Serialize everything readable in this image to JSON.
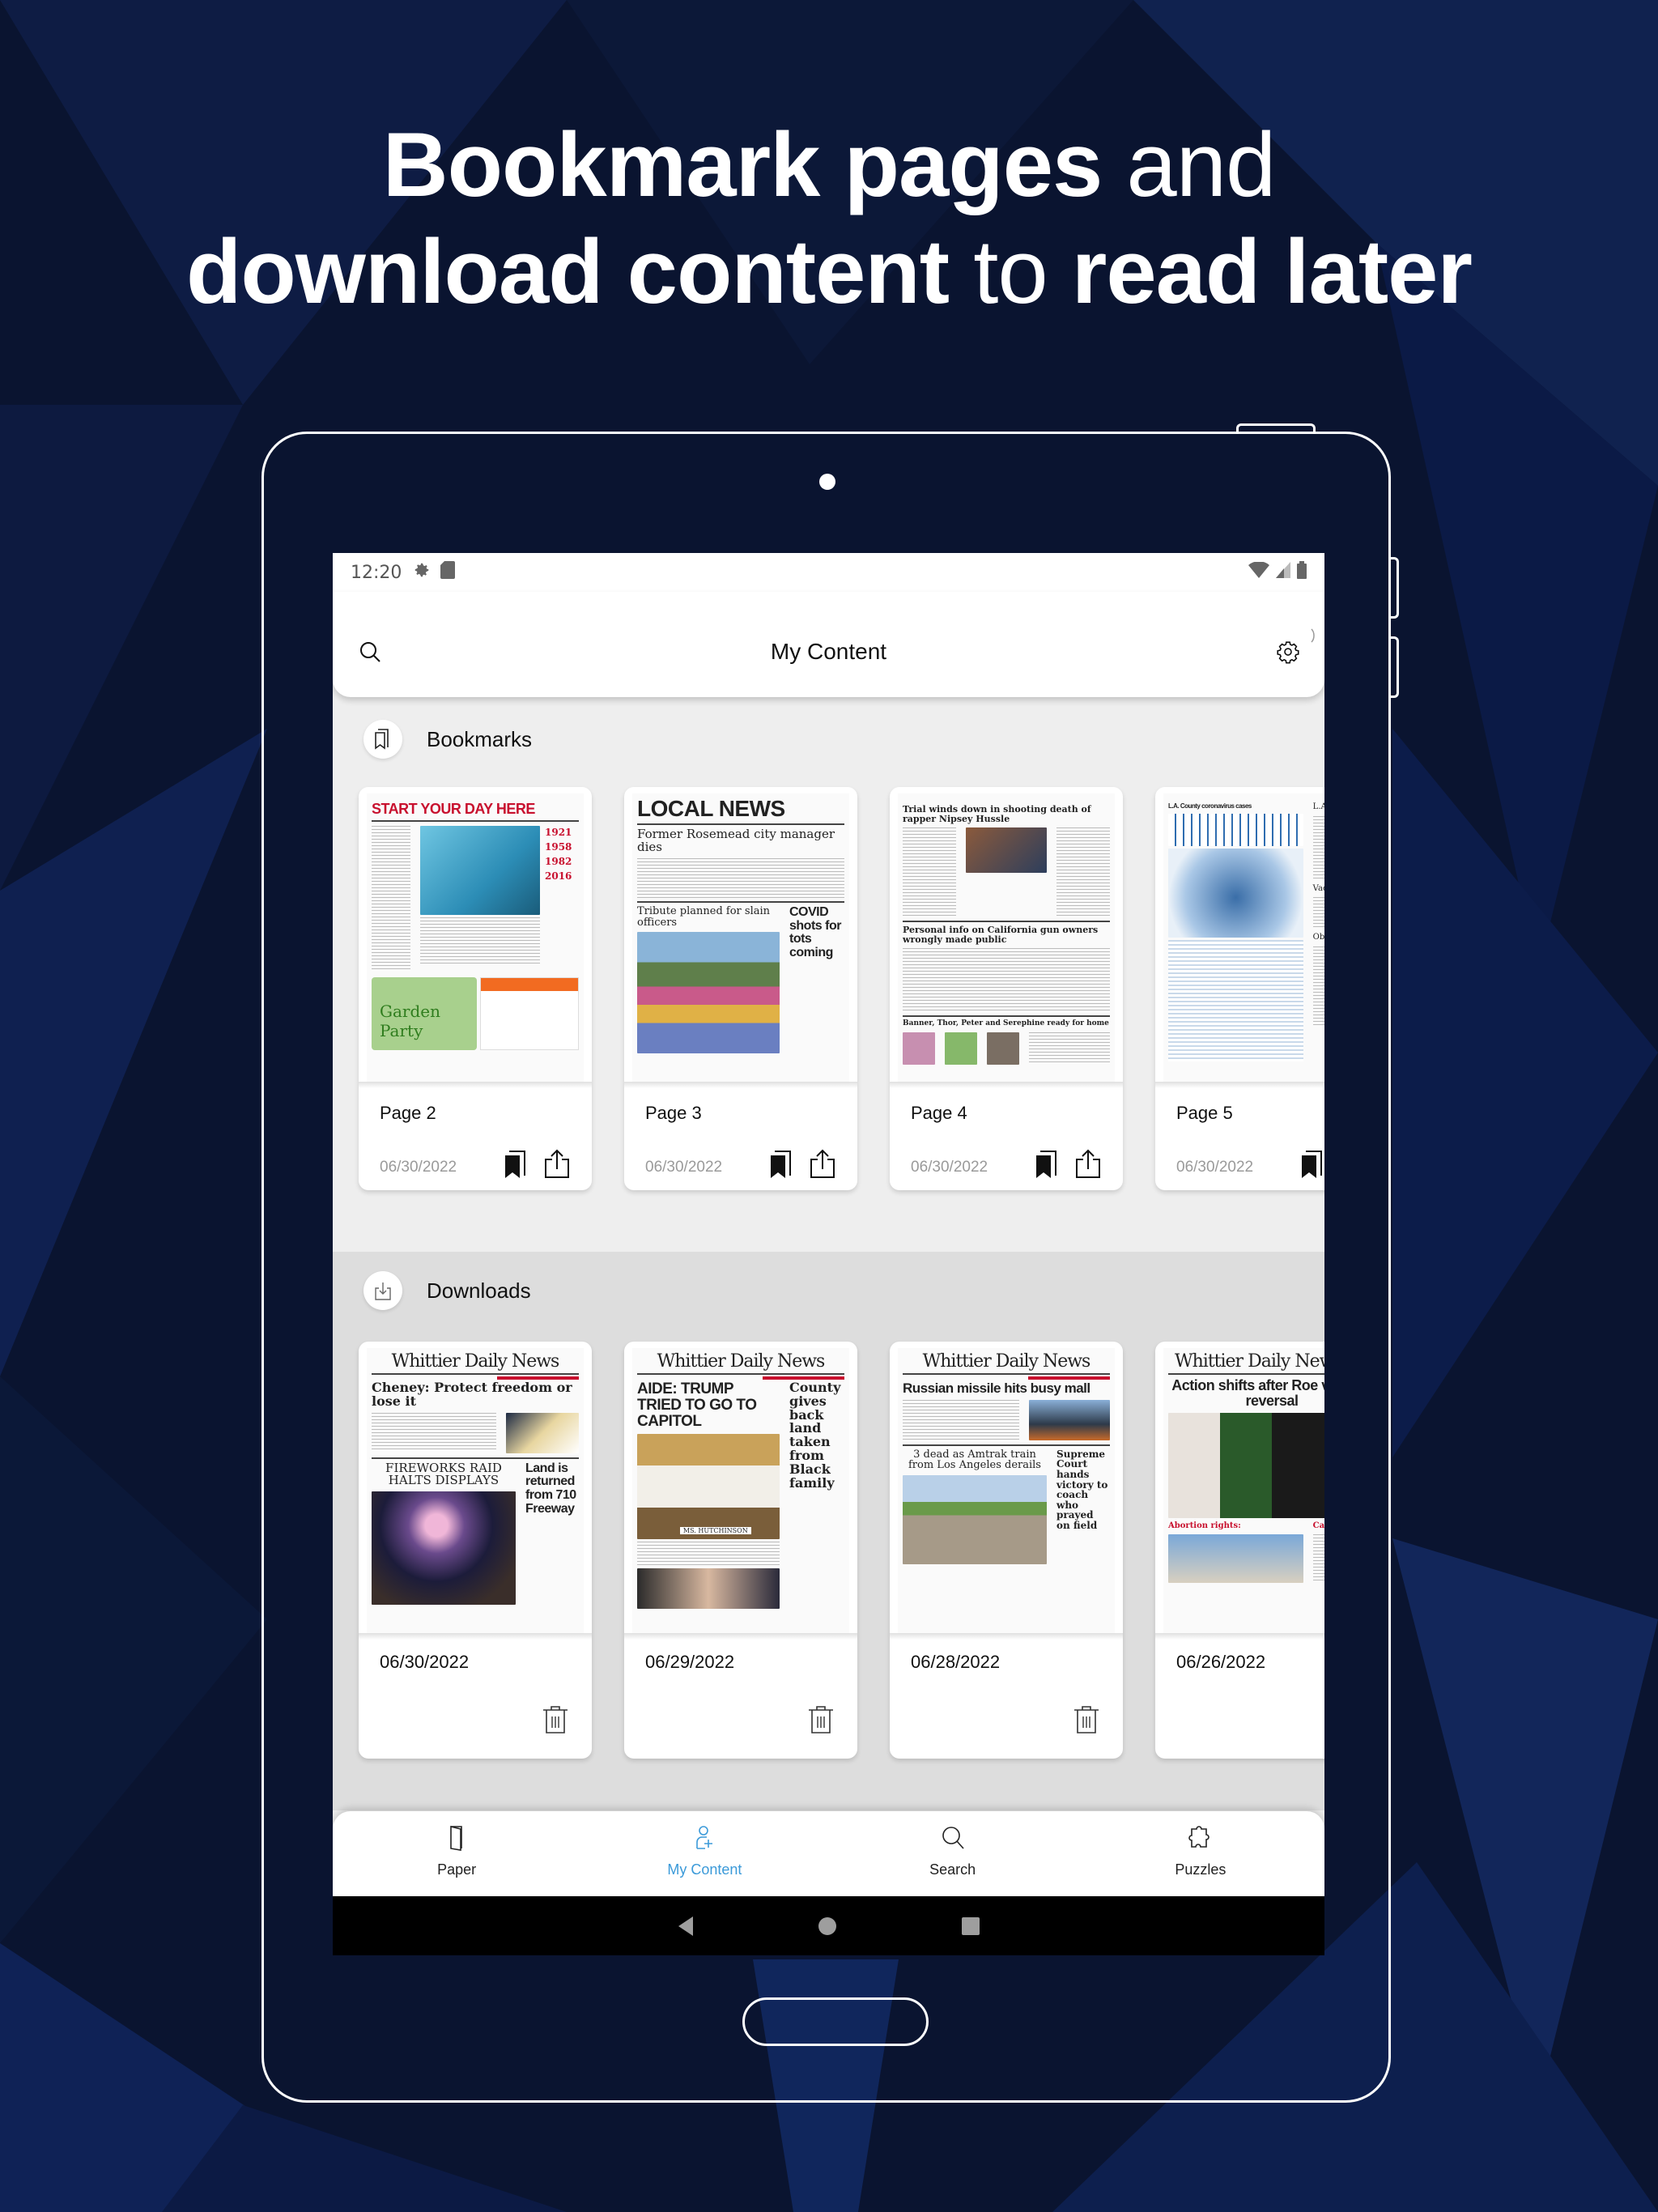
{
  "headline": {
    "line1": [
      {
        "text": "Bookmark pages",
        "bold": true
      },
      {
        "text": " and",
        "bold": false
      }
    ],
    "line2": [
      {
        "text": "download content",
        "bold": true
      },
      {
        "text": " to ",
        "bold": false
      },
      {
        "text": "read later",
        "bold": true
      }
    ]
  },
  "colors": {
    "background": "#0a1430",
    "accent": "#3b9ad9",
    "bookmarks_bg": "#eeeeee",
    "downloads_bg": "#dddddd"
  },
  "status_bar": {
    "time": "12:20",
    "left_icons": [
      "gear-icon",
      "sd-card-icon"
    ],
    "right_icons": [
      "wifi-icon",
      "signal-icon",
      "battery-icon"
    ]
  },
  "app_bar": {
    "title": "My Content",
    "left_icon": "search-icon",
    "right_icon": "settings-gear-icon"
  },
  "bookmarks": {
    "label": "Bookmarks",
    "icon": "bookmarks-icon",
    "items": [
      {
        "page": "Page 2",
        "date": "06/30/2022",
        "thumb_headline": "START YOUR DAY HERE",
        "thumb_sub": "Garden Party"
      },
      {
        "page": "Page 3",
        "date": "06/30/2022",
        "thumb_headline": "LOCAL NEWS",
        "thumb_sub": "Former Rosemead city manager dies",
        "thumb_extra": "Tribute planned for slain officers",
        "thumb_side": "COVID shots for tots coming"
      },
      {
        "page": "Page 4",
        "date": "06/30/2022",
        "thumb_headline": "Trial winds down in shooting death of rapper Nipsey Hussle",
        "thumb_sub": "Personal info on California gun owners wrongly made public",
        "thumb_extra": "Banner, Thor, Peter and Serephine ready for home"
      },
      {
        "page": "Page 5",
        "date": "06/30/2022",
        "thumb_headline": "L.A. County coronavirus cases",
        "thumb_sub": "L.A. County",
        "thumb_extra": "Vaccines",
        "thumb_side": "Obituary"
      }
    ]
  },
  "downloads": {
    "label": "Downloads",
    "icon": "download-icon",
    "items": [
      {
        "date": "06/30/2022",
        "masthead": "Whittier Daily News",
        "thumb_headline": "Cheney: Protect freedom or lose it",
        "thumb_sub": "FIREWORKS RAID HALTS DISPLAYS",
        "thumb_side": "Land is returned from 710 Freeway"
      },
      {
        "date": "06/29/2022",
        "masthead": "Whittier Daily News",
        "thumb_headline": "AIDE: TRUMP TRIED TO GO TO CAPITOL",
        "thumb_sub": "MS. HUTCHINSON",
        "thumb_side": "County gives back land taken from Black family"
      },
      {
        "date": "06/28/2022",
        "masthead": "Whittier Daily News",
        "thumb_headline": "Russian missile hits busy mall",
        "thumb_sub": "3 dead as Amtrak train from Los Angeles derails",
        "thumb_side": "Supreme Court hands victory to coach who prayed on field"
      },
      {
        "date": "06/26/2022",
        "masthead": "Whittier Daily News",
        "thumb_headline": "Action shifts after Roe v. Wade reversal",
        "thumb_sub": "Abortion rights:",
        "thumb_side": "California:"
      }
    ]
  },
  "bottom_nav": {
    "items": [
      {
        "label": "Paper",
        "icon": "paper-icon",
        "active": false
      },
      {
        "label": "My Content",
        "icon": "my-content-icon",
        "active": true
      },
      {
        "label": "Search",
        "icon": "search-icon",
        "active": false
      },
      {
        "label": "Puzzles",
        "icon": "puzzle-icon",
        "active": false
      }
    ]
  },
  "system_nav": [
    "back-icon",
    "home-icon",
    "recents-icon"
  ]
}
